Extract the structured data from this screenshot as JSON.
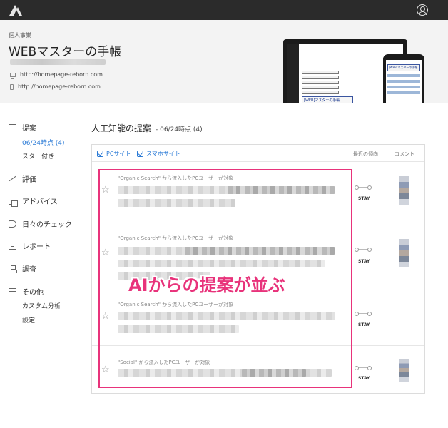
{
  "header": {
    "business_label": "個人事業",
    "site_title": "WEBマスターの手帳",
    "pc_url": "http://homepage-reborn.com",
    "sp_url": "http://homepage-reborn.com",
    "laptop_banner": "[WEB]マスターの手帳",
    "phone_banner": "[WEB]マスターの手帳"
  },
  "sidebar": {
    "suggestions": "提案",
    "date_item": "06/24時点 (4)",
    "starred": "スター付き",
    "evaluation": "評価",
    "advice": "アドバイス",
    "daily_check": "日々のチェック",
    "report": "レポート",
    "research": "調査",
    "other": "その他",
    "custom_analysis": "カスタム分析",
    "settings": "設定"
  },
  "main": {
    "title": "人工知能の提案",
    "date": "- 06/24時点 (4)",
    "filters": [
      "PCサイト",
      "スマホサイト"
    ],
    "columns": {
      "trend": "最近の傾向",
      "comment": "コメント"
    },
    "rows": [
      {
        "segment": "\"Organic Search\" から流入したPCユーザーが対象",
        "trend": "STAY"
      },
      {
        "segment": "\"Organic Search\" から流入したPCユーザーが対象",
        "trend": "STAY"
      },
      {
        "segment": "\"Organic Search\" から流入したPCユーザーが対象",
        "trend": "STAY"
      },
      {
        "segment": "\"Social\" から流入したPCユーザーが対象",
        "trend": "STAY"
      }
    ]
  },
  "annotation": {
    "text": "AIからの提案が並ぶ",
    "color": "#e8337b"
  },
  "colors": {
    "topbar": "#2b2b2b",
    "accent": "#2a7ad6",
    "highlight": "#e8337b"
  }
}
